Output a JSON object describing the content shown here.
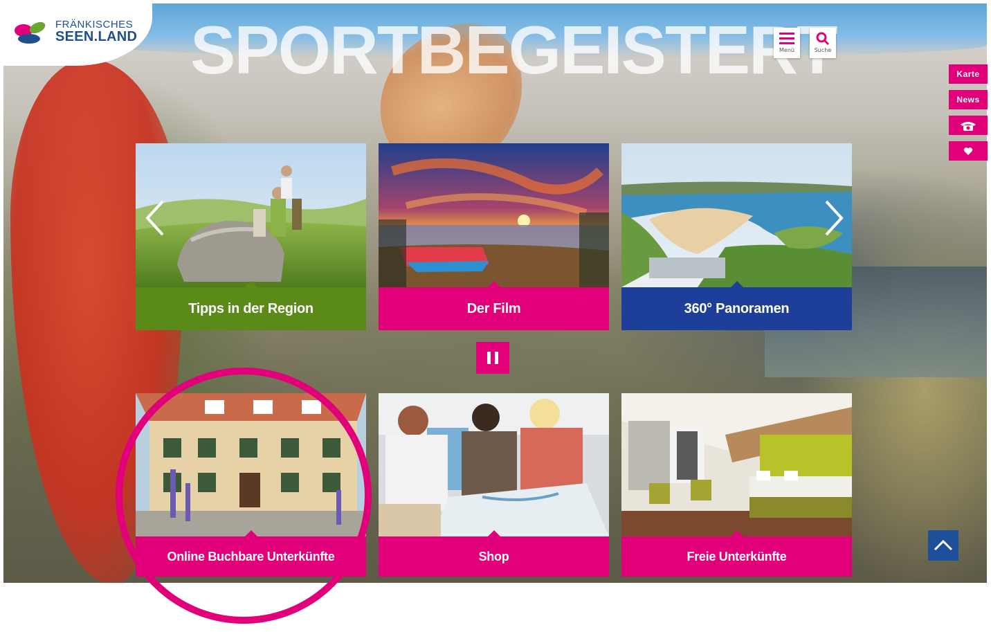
{
  "hero": {
    "headline": "SPORTBEGEISTERT"
  },
  "logo": {
    "line1": "FRÄNKISCHES",
    "line2": "SEEN.LAND"
  },
  "topbar": {
    "menu_label": "Menü",
    "search_label": "Suche"
  },
  "side_tabs": {
    "map": "Karte",
    "news": "News",
    "phone_icon": "phone-icon",
    "heart_icon": "heart-icon"
  },
  "tiles": [
    {
      "label": "Tipps in der Region",
      "color": "#5a8a17"
    },
    {
      "label": "Der Film",
      "color": "#e2007a"
    },
    {
      "label": "360° Panoramen",
      "color": "#1d3f99"
    },
    {
      "label": "Online Buchbare Unterkünfte",
      "color": "#e2007a"
    },
    {
      "label": "Shop",
      "color": "#e2007a"
    },
    {
      "label": "Freie Unterkünfte",
      "color": "#e2007a"
    }
  ],
  "colors": {
    "brand_pink": "#e2007a",
    "brand_blue": "#1d4f9a",
    "green": "#5a8a17",
    "navy": "#1d3f99"
  }
}
